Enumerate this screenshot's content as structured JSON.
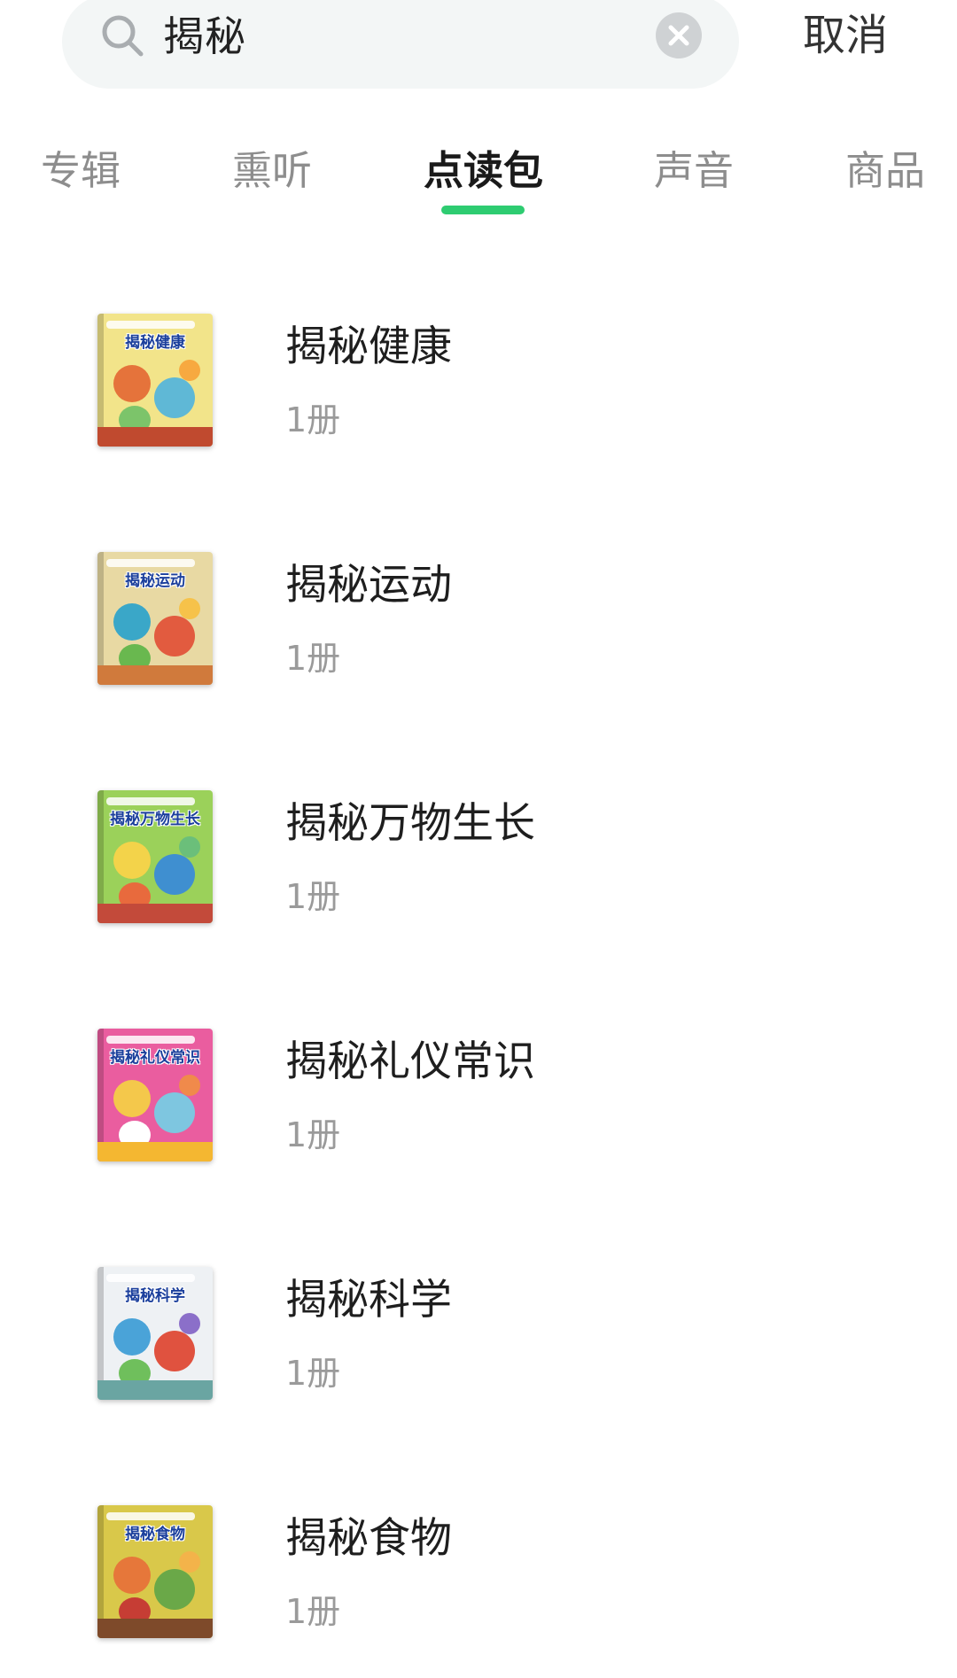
{
  "search": {
    "query": "揭秘",
    "cancel_label": "取消"
  },
  "tabs": [
    {
      "label": "专辑",
      "active": false
    },
    {
      "label": "熏听",
      "active": false
    },
    {
      "label": "点读包",
      "active": true
    },
    {
      "label": "声音",
      "active": false
    },
    {
      "label": "商品",
      "active": false
    }
  ],
  "colors": {
    "accent": "#2ecc71",
    "search_bg": "#f3f6f6",
    "icon_gray": "#c8c8c8"
  },
  "results": [
    {
      "title": "揭秘健康",
      "count": "1册",
      "cover_title": "揭秘健康",
      "cover_colors": [
        "#f2e48a",
        "#e5733b",
        "#5fb8d6",
        "#7cc46a",
        "#f7a940",
        "#c04a2f"
      ]
    },
    {
      "title": "揭秘运动",
      "count": "1册",
      "cover_title": "揭秘运动",
      "cover_colors": [
        "#e8d9a3",
        "#3aa7c8",
        "#e25b3f",
        "#69b84f",
        "#f6c24a",
        "#d07a3c"
      ]
    },
    {
      "title": "揭秘万物生长",
      "count": "1册",
      "cover_title": "揭秘万物生长",
      "cover_colors": [
        "#9bd15a",
        "#f3d34a",
        "#3f8fd0",
        "#e86a3d",
        "#6bbf7a",
        "#c34a3a"
      ]
    },
    {
      "title": "揭秘礼仪常识",
      "count": "1册",
      "cover_title": "揭秘礼仪常识",
      "cover_colors": [
        "#ea5d9f",
        "#f4c84b",
        "#7ec6e0",
        "#ffffff",
        "#f08a4b",
        "#f4b731"
      ]
    },
    {
      "title": "揭秘科学",
      "count": "1册",
      "cover_title": "揭秘科学",
      "cover_colors": [
        "#eef1f4",
        "#4aa3d8",
        "#e0523f",
        "#6fbf5c",
        "#8b6fc9",
        "#6aa5a2"
      ]
    },
    {
      "title": "揭秘食物",
      "count": "1册",
      "cover_title": "揭秘食物",
      "cover_colors": [
        "#d9c84a",
        "#e6773a",
        "#6aa848",
        "#c63d34",
        "#f3b34a",
        "#7e4a2a"
      ]
    }
  ]
}
